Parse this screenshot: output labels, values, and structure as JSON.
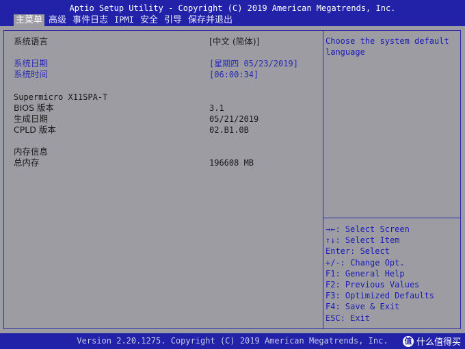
{
  "header": {
    "title": "Aptio Setup Utility - Copyright (C) 2019 American Megatrends, Inc.",
    "tabs": [
      {
        "label": "主菜单",
        "active": true
      },
      {
        "label": "高级",
        "active": false
      },
      {
        "label": "事件日志",
        "active": false
      },
      {
        "label": "IPMI",
        "active": false
      },
      {
        "label": "安全",
        "active": false
      },
      {
        "label": "引导",
        "active": false
      },
      {
        "label": "保存并退出",
        "active": false
      }
    ]
  },
  "main": {
    "language_label": "系统语言",
    "language_value": "[中文 (简体)]",
    "date_label": "系统日期",
    "date_value": "[星期四 05/23/2019]",
    "time_label": "系统时间",
    "time_value": "[06:00:34]",
    "board_name": "Supermicro X11SPA-T",
    "bios_label": "BIOS 版本",
    "bios_value": "3.1",
    "build_date_label": "生成日期",
    "build_date_value": "05/21/2019",
    "cpld_label": "CPLD 版本",
    "cpld_value": "02.B1.0B",
    "memory_section": "内存信息",
    "total_memory_label": "总内存",
    "total_memory_value": "196608 MB"
  },
  "help_text": "Choose the system default language",
  "keys": [
    "→←: Select Screen",
    "↑↓: Select Item",
    "Enter: Select",
    "+/-: Change Opt.",
    "F1: General Help",
    "F2: Previous Values",
    "F3: Optimized Defaults",
    "F4: Save & Exit",
    "ESC: Exit"
  ],
  "footer": "Version 2.20.1275. Copyright (C) 2019 American Megatrends, Inc.",
  "watermark": "什么值得买",
  "watermark_badge": "值",
  "colors": {
    "bar_blue": "#2222a8",
    "panel_gray": "#9c9ca2",
    "text_blue": "#2828b8"
  }
}
